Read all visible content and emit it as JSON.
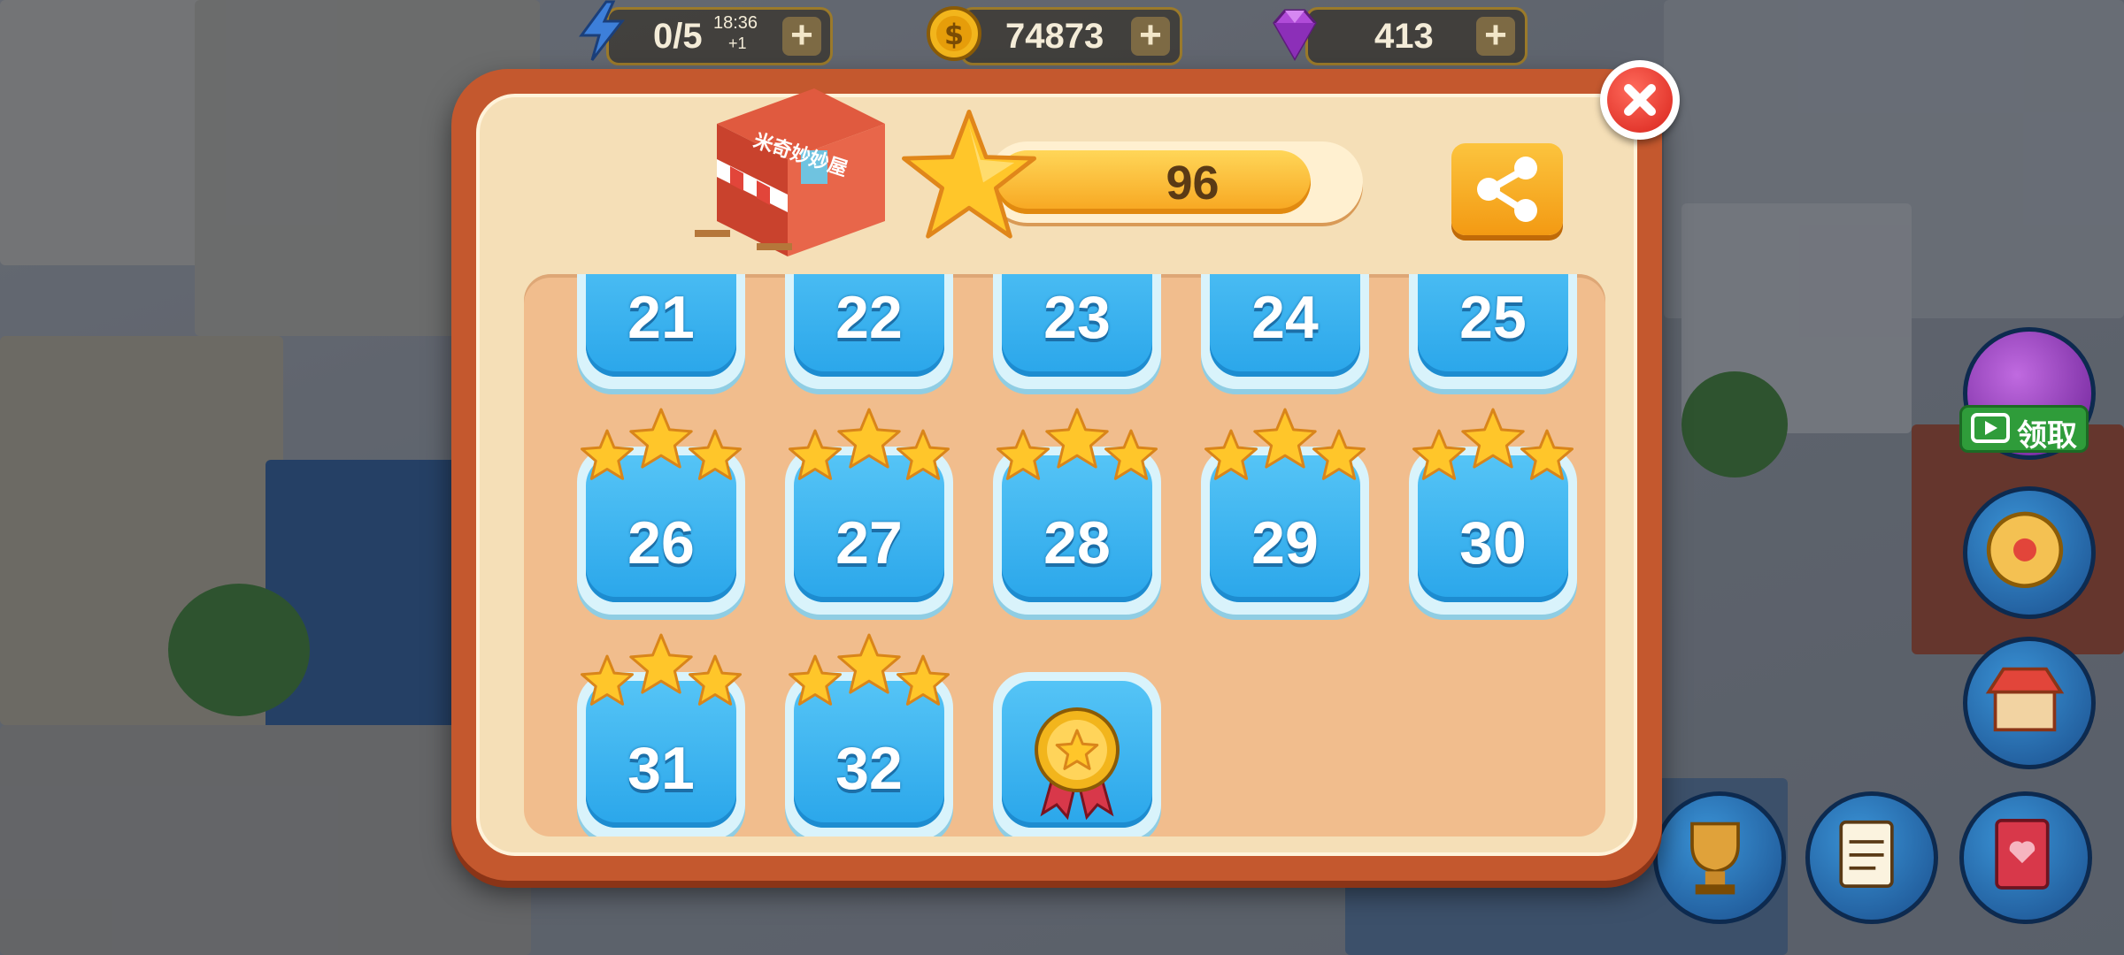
{
  "resources": {
    "energy": {
      "icon": "lightning-icon",
      "value": "0/5",
      "timer": "18:36",
      "timer_sub": "+1"
    },
    "coins": {
      "icon": "coin-icon",
      "value": "74873"
    },
    "gems": {
      "icon": "gem-icon",
      "value": "413"
    },
    "plus_label": "+"
  },
  "dialog": {
    "shop_sign": "米奇妙妙屋",
    "star_total": "96",
    "progress_fraction": 0.88
  },
  "levels": [
    {
      "label": "21"
    },
    {
      "label": "22"
    },
    {
      "label": "23"
    },
    {
      "label": "24"
    },
    {
      "label": "25"
    },
    {
      "label": "26",
      "stars": 3
    },
    {
      "label": "27",
      "stars": 3
    },
    {
      "label": "28",
      "stars": 3
    },
    {
      "label": "29",
      "stars": 3
    },
    {
      "label": "30",
      "stars": 3
    },
    {
      "label": "31",
      "stars": 3
    },
    {
      "label": "32",
      "stars": 3
    },
    {
      "icon": "medal-reward-icon"
    }
  ],
  "side": {
    "claim_label": "领取"
  },
  "colors": {
    "frame": "#c4582e",
    "panel": "#f5dfb7",
    "grid": "#f1bd8d",
    "tile": "#2aa6ea",
    "star": "#ffc62a",
    "share": "#f39a13",
    "close": "#d8231b"
  }
}
